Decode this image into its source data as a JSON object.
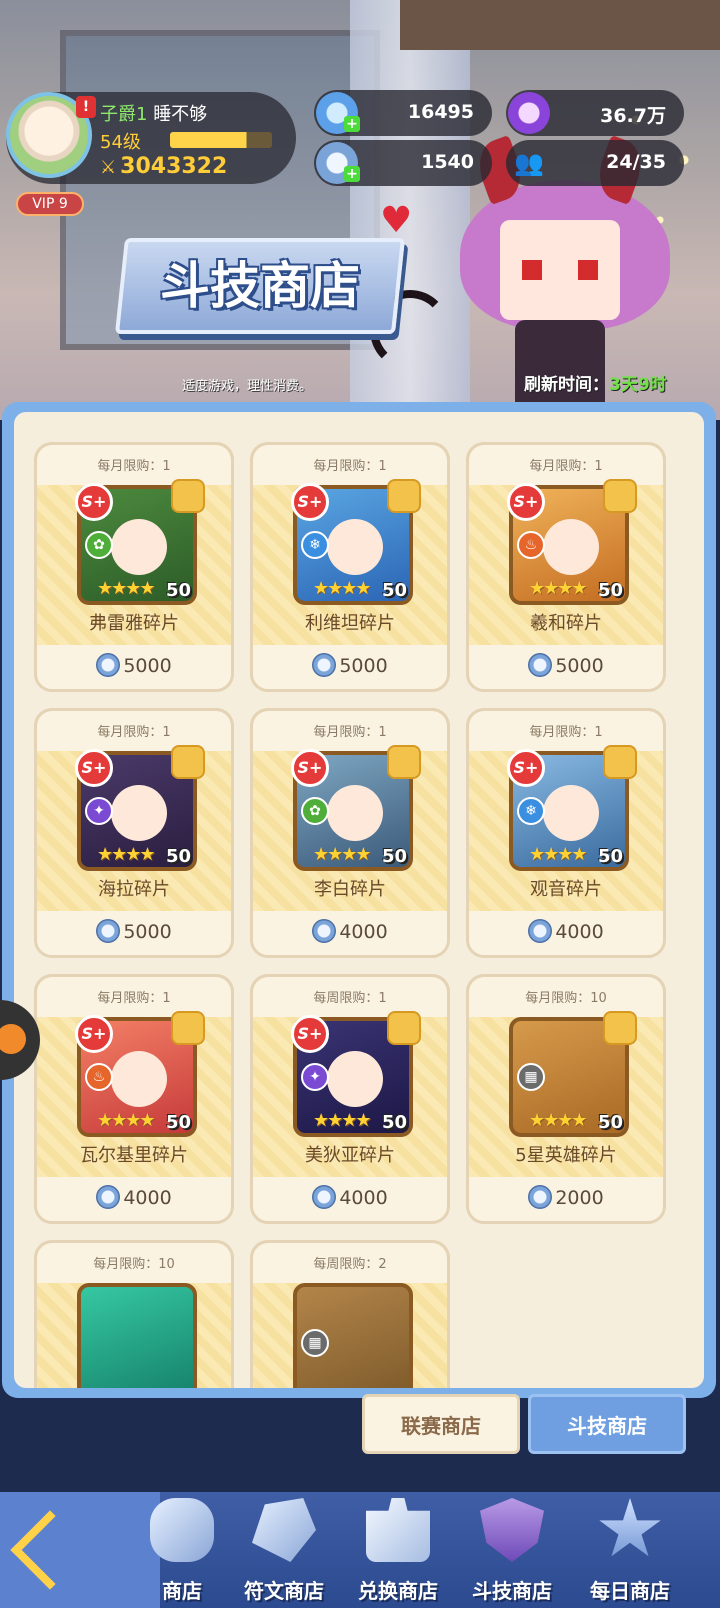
{
  "player": {
    "rank": "子爵1",
    "name": "睡不够",
    "level": "54级",
    "xp_progress": 0.75,
    "power": "3043322",
    "vip": "VIP 9",
    "alert": "!"
  },
  "resources": {
    "diamond": "16495",
    "purple_gem": "36.7万",
    "arena_coin": "1540",
    "members": "24/35"
  },
  "shop": {
    "title": "斗技商店",
    "advice": "适度游戏，理性消费。",
    "refresh_label": "刷新时间：",
    "refresh_time": "3天9时"
  },
  "items": [
    {
      "limit": "每月限购：1",
      "name": "弗雷雅碎片",
      "price": "5000",
      "grade": "S+",
      "stars": "★★★★",
      "level": "50",
      "element": "nature-icon",
      "color": "g"
    },
    {
      "limit": "每月限购：1",
      "name": "利维坦碎片",
      "price": "5000",
      "grade": "S+",
      "stars": "★★★★",
      "level": "50",
      "element": "water-icon",
      "color": "b"
    },
    {
      "limit": "每月限购：1",
      "name": "羲和碎片",
      "price": "5000",
      "grade": "S+",
      "stars": "★★★★",
      "level": "50",
      "element": "fire-icon",
      "color": "o"
    },
    {
      "limit": "每月限购：1",
      "name": "海拉碎片",
      "price": "5000",
      "grade": "S+",
      "stars": "★★★★",
      "level": "50",
      "element": "dark-icon",
      "color": "p"
    },
    {
      "limit": "每月限购：1",
      "name": "李白碎片",
      "price": "4000",
      "grade": "S+",
      "stars": "★★★★",
      "level": "50",
      "element": "nature-icon",
      "color": "w"
    },
    {
      "limit": "每月限购：1",
      "name": "观音碎片",
      "price": "4000",
      "grade": "S+",
      "stars": "★★★★",
      "level": "50",
      "element": "water-icon",
      "color": "n"
    },
    {
      "limit": "每月限购：1",
      "name": "瓦尔基里碎片",
      "price": "4000",
      "grade": "S+",
      "stars": "★★★★",
      "level": "50",
      "element": "fire-icon",
      "color": "r"
    },
    {
      "limit": "每周限购：1",
      "name": "美狄亚碎片",
      "price": "4000",
      "grade": "S+",
      "stars": "★★★★",
      "level": "50",
      "element": "dark-icon",
      "color": "v"
    },
    {
      "limit": "每月限购：10",
      "name": "5星英雄碎片",
      "price": "2000",
      "grade": "",
      "stars": "★★★★",
      "level": "50",
      "element": "grid-icon",
      "color": "gold"
    },
    {
      "limit": "每月限购：10",
      "name": "",
      "price": "",
      "grade": "",
      "stars": "",
      "level": "",
      "element": "",
      "color": "teal"
    },
    {
      "limit": "每周限购：2",
      "name": "",
      "price": "",
      "grade": "",
      "stars": "",
      "level": "",
      "element": "grid-icon",
      "color": "coin"
    }
  ],
  "tabs": {
    "league": "联赛商店",
    "arena": "斗技商店"
  },
  "nav": {
    "partial": "商店",
    "rune": "符文商店",
    "exchange": "兑换商店",
    "arena": "斗技商店",
    "daily": "每日商店"
  },
  "colors": {
    "panel_border": "#7db0e8",
    "panel_bg": "#f6eedd",
    "active_tab": "#6f9fe0",
    "nav_bg": "#3f5ea6"
  }
}
